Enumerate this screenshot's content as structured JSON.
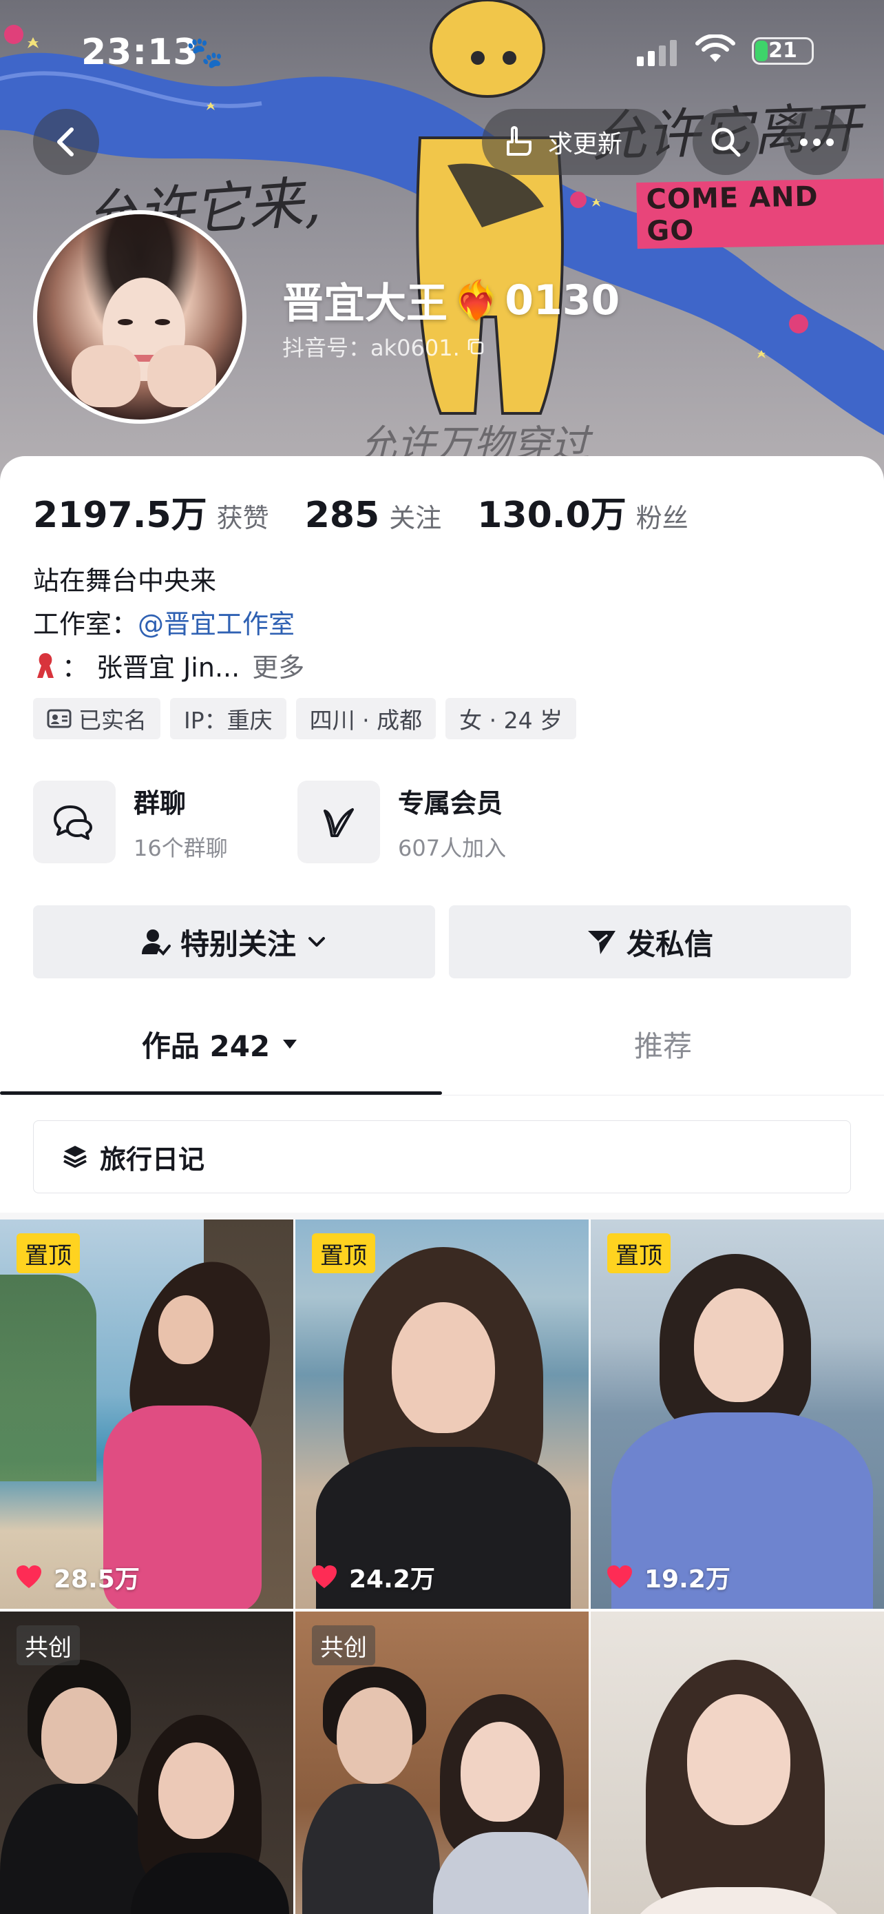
{
  "status": {
    "time": "23:13",
    "battery": "21"
  },
  "banner": {
    "art_left": "允许它来,",
    "art_right": "允许它离开",
    "caption": "COME AND GO",
    "art_bottom": "允许万物穿过"
  },
  "nav": {
    "update_label": "求更新"
  },
  "profile": {
    "name": "晋宜大王",
    "name_suffix": "0130",
    "douyin_id": "抖音号：ak0601."
  },
  "stats": [
    {
      "num": "2197.5万",
      "label": "获赞"
    },
    {
      "num": "285",
      "label": "关注"
    },
    {
      "num": "130.0万",
      "label": "粉丝"
    }
  ],
  "bio": {
    "line1": "站在舞台中央来",
    "line2_prefix": "工作室：",
    "line2_link": "@晋宜工作室",
    "line3_prefix": "：",
    "line3_text": "张晋宜 Jin...",
    "line3_more": "更多"
  },
  "tags": [
    "已实名",
    "IP：重庆",
    "四川 · 成都",
    "女 · 24 岁"
  ],
  "features": [
    {
      "title": "群聊",
      "sub": "16个群聊",
      "icon": "chat-bubbles-icon"
    },
    {
      "title": "专属会员",
      "sub": "607人加入",
      "icon": "v-badge-icon"
    }
  ],
  "actions": {
    "follow": "特别关注",
    "message": "发私信"
  },
  "tabs": {
    "works": "作品 242",
    "recommend": "推荐"
  },
  "collection": {
    "label": "旅行日记"
  },
  "grid": [
    {
      "badge": "置顶",
      "likes": "28.5万"
    },
    {
      "badge": "置顶",
      "likes": "24.2万"
    },
    {
      "badge": "置顶",
      "likes": "19.2万"
    },
    {
      "badge": "共创",
      "likes": ""
    },
    {
      "badge": "共创",
      "likes": ""
    },
    {
      "badge": "",
      "likes": ""
    }
  ],
  "colors": {
    "pin": "#ffd320",
    "link": "#2f61b3",
    "heart": "#fe2c55"
  }
}
